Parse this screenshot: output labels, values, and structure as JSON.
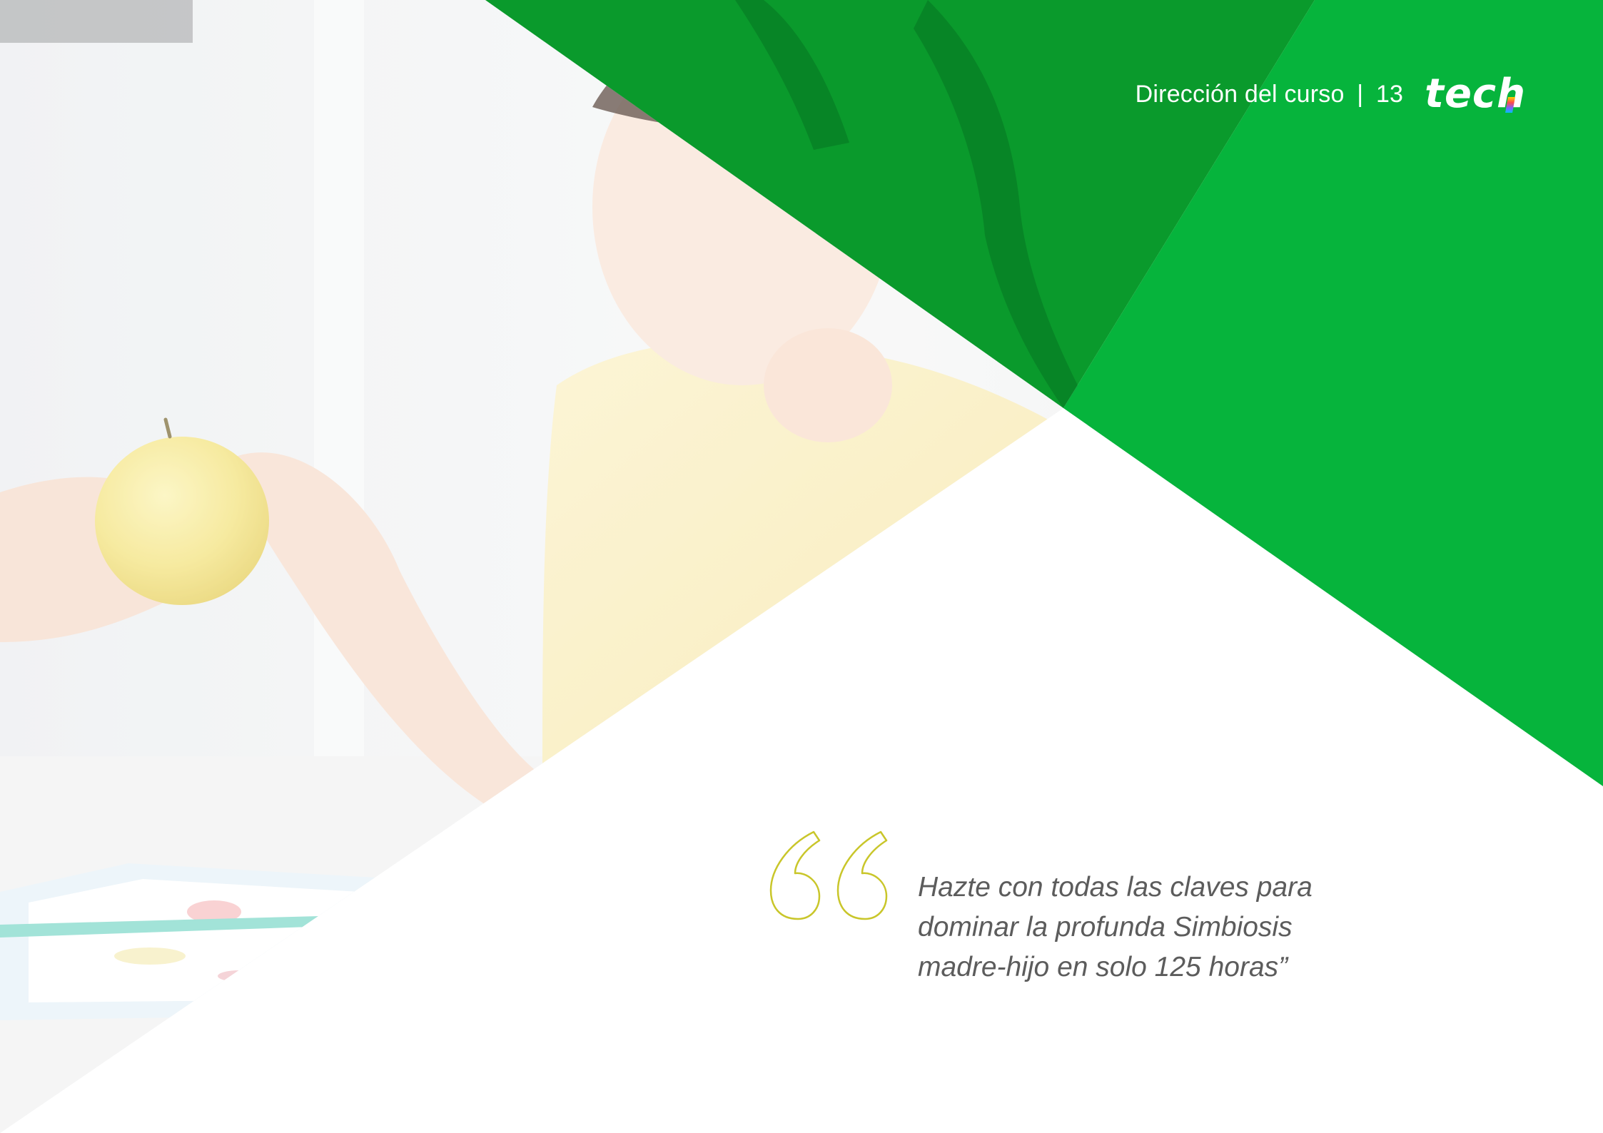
{
  "header": {
    "section_title": "Dirección del curso",
    "separator": "|",
    "page_number": "13",
    "logo_text": "tech",
    "logo_main": "tec",
    "logo_last": "h"
  },
  "quote": {
    "lines": [
      "Hazte con todas las claves para",
      "dominar la profunda Simbiosis",
      "madre-hijo en solo 125 horas”"
    ]
  },
  "colors": {
    "brand_green": "#06b43c",
    "dark_green": "#0a9a2c",
    "quote_mark": "#c9c62a",
    "quote_text": "#5c5c5c"
  },
  "icons": {
    "quote_mark": "double-opening-quote-outline-icon"
  }
}
